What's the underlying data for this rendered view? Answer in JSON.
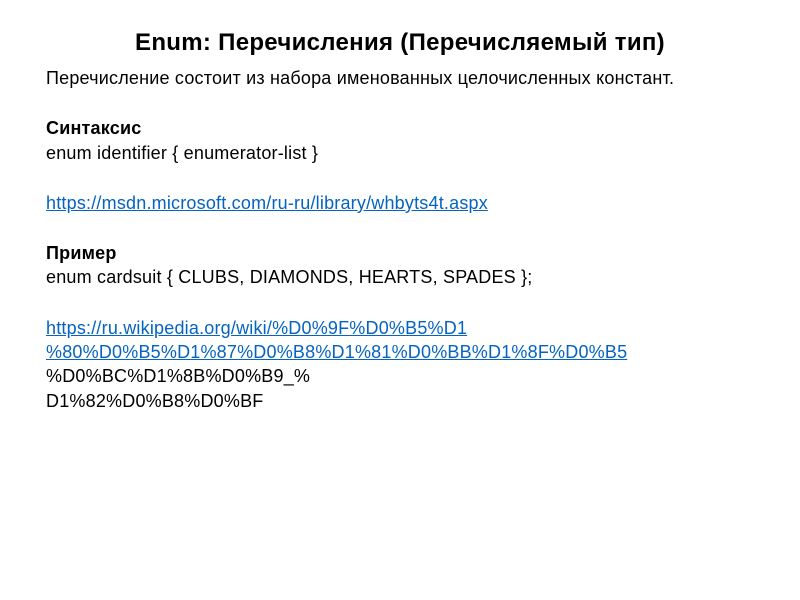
{
  "title": "Enum: Перечисления (Перечисляемый тип)",
  "intro": "Перечисление состоит из набора именованных целочисленных констант.",
  "syntax_heading": "Синтаксис",
  "syntax_code": "enum identifier { enumerator-list }",
  "link1": "https://msdn.microsoft.com/ru-ru/library/whbyts4t.aspx",
  "example_heading": "Пример",
  "example_code": "enum cardsuit { CLUBS, DIAMONDS, HEARTS, SPADES };",
  "link2_line1": "https://ru.wikipedia.org/wiki/%D0%9F%D0%B5%D1",
  "link2_line2": "%80%D0%B5%D1%87%D0%B8%D1%81%D0%BB%D1%8F%D0%B5",
  "link2_line3": "%D0%BC%D1%8B%D0%B9_%",
  "link2_tail": "D1%82%D0%B8%D0%BF"
}
